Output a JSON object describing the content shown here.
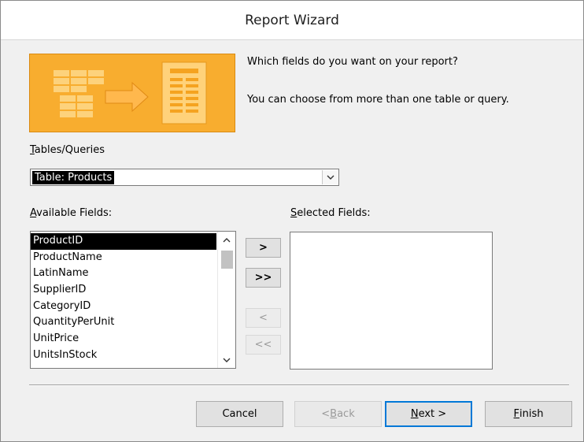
{
  "window": {
    "title": "Report Wizard"
  },
  "intro": {
    "line1": "Which fields do you want on your report?",
    "line2": "You can choose from more than one table or query."
  },
  "tables_queries": {
    "label_access_key": "T",
    "label_rest": "ables/Queries",
    "selected": "Table: Products",
    "dropdown_icon": "chevron-down-icon"
  },
  "available_fields": {
    "label_access_key": "A",
    "label_rest": "vailable Fields:",
    "items": [
      "ProductID",
      "ProductName",
      "LatinName",
      "SupplierID",
      "CategoryID",
      "QuantityPerUnit",
      "UnitPrice",
      "UnitsInStock"
    ],
    "selected_index": 0
  },
  "selected_fields": {
    "label_access_key": "S",
    "label_rest": "elected Fields:",
    "items": []
  },
  "move_buttons": {
    "add_one": ">",
    "add_all": ">>",
    "remove_one": "<",
    "remove_all": "<<"
  },
  "footer": {
    "cancel": "Cancel",
    "back_pre": "< ",
    "back_key": "B",
    "back_rest": "ack",
    "next_key": "N",
    "next_rest": "ext >",
    "finish_key": "F",
    "finish_rest": "inish"
  },
  "colors": {
    "banner": "#f5a320",
    "default_button_border": "#0078d7",
    "selection": "#000000"
  }
}
